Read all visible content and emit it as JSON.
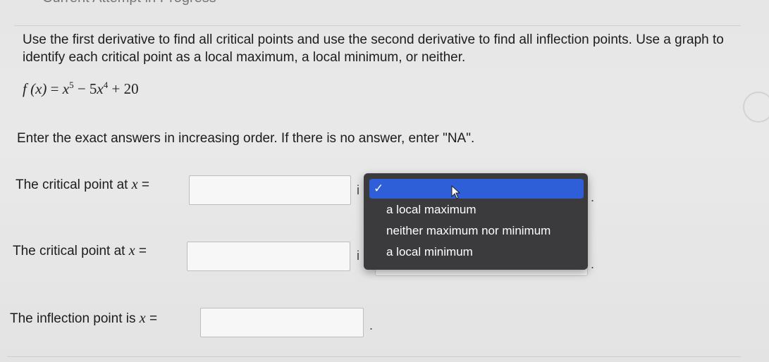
{
  "header": {
    "title_fragment": "Current Attempt in Progress"
  },
  "question": {
    "instructions": "Use the first derivative to find all critical points and use the second derivative to find all inflection points. Use a graph to identify each critical point as a local maximum, a local minimum, or neither.",
    "function_name": "f (x)",
    "function_equals": "=",
    "function_expr_parts": [
      "x",
      "5",
      " − 5",
      "x",
      "4",
      " + 20"
    ],
    "enter_note": "Enter the exact answers in increasing order. If there is no answer, enter \"NA\"."
  },
  "rows": [
    {
      "label": "The critical point at",
      "var": "x",
      "eq": "=",
      "value": "",
      "is_text": "i"
    },
    {
      "label": "The critical point at",
      "var": "x",
      "eq": "=",
      "value": "",
      "is_text": "i"
    },
    {
      "label": "The inflection point is",
      "var": "x",
      "eq": "=",
      "value": "",
      "trailing": "."
    }
  ],
  "dropdown": {
    "selected_index": 0,
    "checkmark": "✓",
    "options": [
      "",
      "a local maximum",
      "neither maximum nor minimum",
      "a local minimum"
    ],
    "trailing": "."
  }
}
